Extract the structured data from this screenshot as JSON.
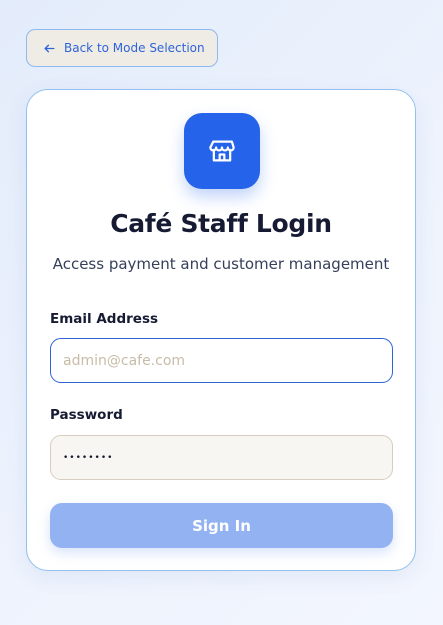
{
  "back_button": {
    "label": "Back to Mode Selection",
    "icon": "arrow-left-icon"
  },
  "card": {
    "logo_icon": "storefront-icon",
    "title": "Café Staff Login",
    "subtitle": "Access payment and customer management"
  },
  "form": {
    "email": {
      "label": "Email Address",
      "placeholder": "admin@cafe.com",
      "value": ""
    },
    "password": {
      "label": "Password",
      "value": "••••••••"
    },
    "submit_label": "Sign In"
  },
  "colors": {
    "accent": "#2563eb",
    "button_disabled": "#92b2f2",
    "back_button_bg": "#efece6"
  }
}
